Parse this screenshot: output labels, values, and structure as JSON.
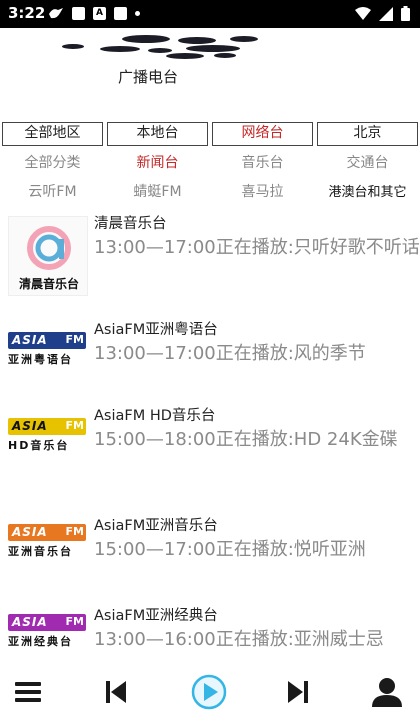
{
  "status_bar": {
    "time": "3:22",
    "icon_a": "A"
  },
  "header": {
    "title": "广播电台"
  },
  "tabs": [
    {
      "label": "全部地区",
      "active": false
    },
    {
      "label": "本地台",
      "active": false
    },
    {
      "label": "网络台",
      "active": true
    },
    {
      "label": "北京",
      "active": false
    }
  ],
  "categories": [
    [
      "全部分类",
      "新闻台",
      "音乐台",
      "交通台"
    ],
    [
      "云听FM",
      "蜻蜓FM",
      "喜马拉",
      "港澳台和其它"
    ]
  ],
  "stations": [
    {
      "name": "清晨音乐台",
      "desc": "13:00—17:00正在播放:只听好歌不听话",
      "logo_text": "清晨音乐台"
    },
    {
      "name": "AsiaFM亚洲粤语台",
      "desc": "13:00—17:00正在播放:风的季节",
      "logo_text": "亚洲粤语台",
      "logo_color": "#1f3f8a"
    },
    {
      "name": "AsiaFM HD音乐台",
      "desc": "15:00—18:00正在播放:HD 24K金碟",
      "logo_text": "HD音乐台",
      "logo_color": "#e6c200"
    },
    {
      "name": "AsiaFM亚洲音乐台",
      "desc": "15:00—17:00正在播放:悦听亚洲",
      "logo_text": "亚洲音乐台",
      "logo_color": "#e87722"
    },
    {
      "name": "AsiaFM亚洲经典台",
      "desc": "13:00—16:00正在播放:亚洲威士忌",
      "logo_text": "亚洲经典台",
      "logo_color": "#a02bb0"
    }
  ],
  "asia_brand": {
    "asia": "ASIA",
    "fm": "FM"
  },
  "colors": {
    "accent": "#c62828",
    "play": "#33b5e5",
    "muted": "#8a8a8a"
  },
  "bottom_bar": {
    "icons": [
      "menu-icon",
      "previous-icon",
      "play-icon",
      "next-icon",
      "user-icon"
    ]
  }
}
